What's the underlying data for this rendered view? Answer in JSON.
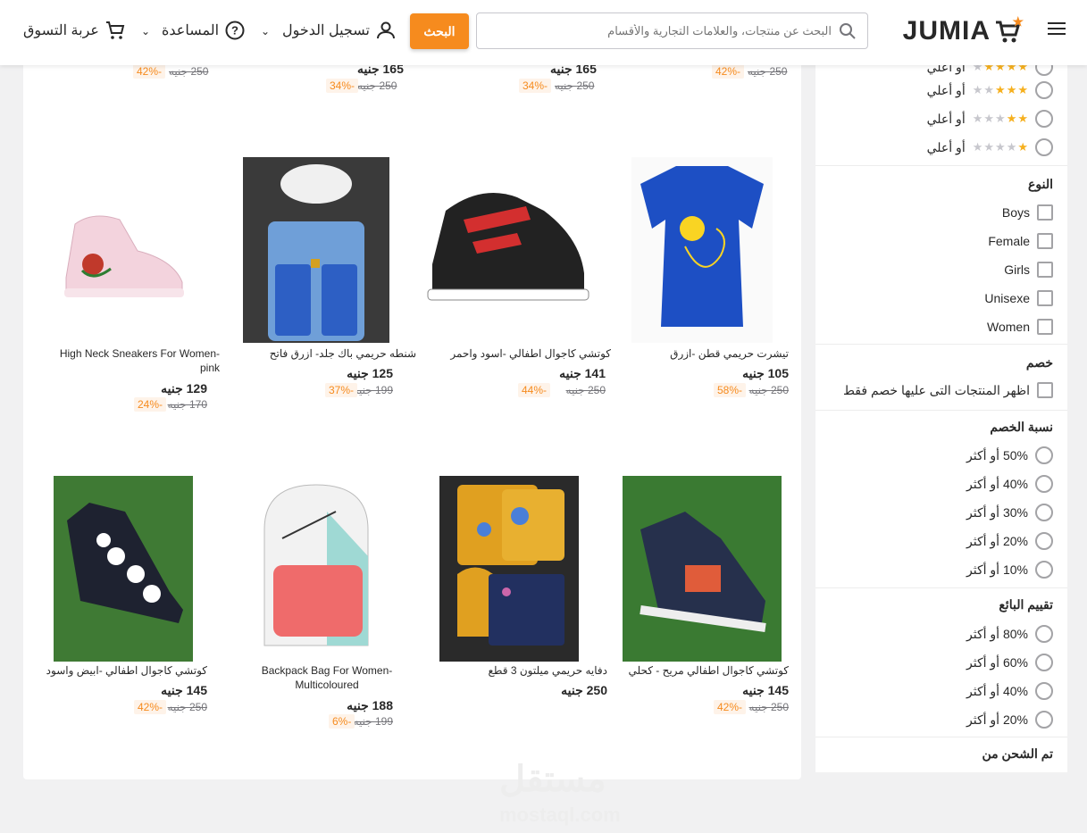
{
  "header": {
    "logo_text": "JUMIA",
    "search_placeholder": "البحث عن منتجات، والعلامات التجارية والأقسام",
    "search_button": "البحث",
    "login": "تسجيل الدخول",
    "help": "المساعدة",
    "cart": "عربة التسوق"
  },
  "currency": "جنيه",
  "top_row": [
    {
      "price": "",
      "old": "250 جنيه",
      "disc": "-42%"
    },
    {
      "price": "165 جنيه",
      "old": "250 جنيه",
      "disc": "-34%"
    },
    {
      "price": "165 جنيه",
      "old": "250 جنيه",
      "disc": "-34%"
    },
    {
      "price": "",
      "old": "250 جنيه",
      "disc": "-42%"
    }
  ],
  "products": [
    {
      "name": "High Neck Sneakers For Women-pink",
      "price": "129 جنيه",
      "old": "170 جنيه",
      "disc": "-24%"
    },
    {
      "name": "شنطه حريمي باك جلد- ازرق فاتح",
      "price": "125 جنيه",
      "old": "199 جنيه",
      "disc": "-37%"
    },
    {
      "name": "كوتشي كاجوال اطفالي -اسود واحمر",
      "price": "141 جنيه",
      "old": "250 جنيه",
      "disc": "-44%"
    },
    {
      "name": "تيشرت حريمي قطن -ازرق",
      "price": "105 جنيه",
      "old": "250 جنيه",
      "disc": "-58%"
    },
    {
      "name": "كوتشي كاجوال اطفالي -ابيض واسود",
      "price": "145 جنيه",
      "old": "250 جنيه",
      "disc": "-42%"
    },
    {
      "name": "Backpack Bag For Women-Multicoloured",
      "price": "188 جنيه",
      "old": "199 جنيه",
      "disc": "-6%"
    },
    {
      "name": "دفايه حريمي ميلتون 3 قطع",
      "price": "250 جنيه",
      "old": "",
      "disc": ""
    },
    {
      "name": "كوتشي كاجوال اطفالي مريح - كحلي",
      "price": "145 جنيه",
      "old": "250 جنيه",
      "disc": "-42%"
    }
  ],
  "sidebar": {
    "rating_rows": [
      {
        "label": "أو أعلي",
        "stars": 3
      },
      {
        "label": "أو أعلي",
        "stars": 2
      },
      {
        "label": "أو أعلي",
        "stars": 1
      }
    ],
    "rating_partial_label": "أو أعلي",
    "type_title": "النوع",
    "type_options": [
      "Boys",
      "Female",
      "Girls",
      "Unisexe",
      "Women"
    ],
    "discount_title": "خصم",
    "discount_option": "اظهر المنتجات التى عليها خصم فقط",
    "percent_title": "نسبة الخصم",
    "percent_options": [
      "50% أو أكثر",
      "40% أو أكثر",
      "30% أو أكثر",
      "20% أو أكثر",
      "10% أو أكثر"
    ],
    "seller_title": "تقييم البائع",
    "seller_options": [
      "80% أو أكثر",
      "60% أو أكثر",
      "40% أو أكثر",
      "20% أو أكثر"
    ],
    "shipping_title": "تم الشحن من"
  },
  "watermark": {
    "ar": "مستقل",
    "en": "mostaql.com"
  },
  "colors": {
    "accent": "#f68b1e",
    "star": "#f6b01e"
  }
}
